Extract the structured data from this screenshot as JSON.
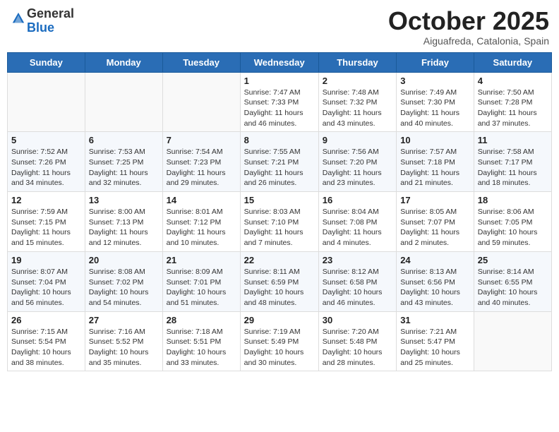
{
  "header": {
    "logo_line1": "General",
    "logo_line2": "Blue",
    "month": "October 2025",
    "location": "Aiguafreda, Catalonia, Spain"
  },
  "weekdays": [
    "Sunday",
    "Monday",
    "Tuesday",
    "Wednesday",
    "Thursday",
    "Friday",
    "Saturday"
  ],
  "weeks": [
    [
      {
        "day": "",
        "info": ""
      },
      {
        "day": "",
        "info": ""
      },
      {
        "day": "",
        "info": ""
      },
      {
        "day": "1",
        "info": "Sunrise: 7:47 AM\nSunset: 7:33 PM\nDaylight: 11 hours and 46 minutes."
      },
      {
        "day": "2",
        "info": "Sunrise: 7:48 AM\nSunset: 7:32 PM\nDaylight: 11 hours and 43 minutes."
      },
      {
        "day": "3",
        "info": "Sunrise: 7:49 AM\nSunset: 7:30 PM\nDaylight: 11 hours and 40 minutes."
      },
      {
        "day": "4",
        "info": "Sunrise: 7:50 AM\nSunset: 7:28 PM\nDaylight: 11 hours and 37 minutes."
      }
    ],
    [
      {
        "day": "5",
        "info": "Sunrise: 7:52 AM\nSunset: 7:26 PM\nDaylight: 11 hours and 34 minutes."
      },
      {
        "day": "6",
        "info": "Sunrise: 7:53 AM\nSunset: 7:25 PM\nDaylight: 11 hours and 32 minutes."
      },
      {
        "day": "7",
        "info": "Sunrise: 7:54 AM\nSunset: 7:23 PM\nDaylight: 11 hours and 29 minutes."
      },
      {
        "day": "8",
        "info": "Sunrise: 7:55 AM\nSunset: 7:21 PM\nDaylight: 11 hours and 26 minutes."
      },
      {
        "day": "9",
        "info": "Sunrise: 7:56 AM\nSunset: 7:20 PM\nDaylight: 11 hours and 23 minutes."
      },
      {
        "day": "10",
        "info": "Sunrise: 7:57 AM\nSunset: 7:18 PM\nDaylight: 11 hours and 21 minutes."
      },
      {
        "day": "11",
        "info": "Sunrise: 7:58 AM\nSunset: 7:17 PM\nDaylight: 11 hours and 18 minutes."
      }
    ],
    [
      {
        "day": "12",
        "info": "Sunrise: 7:59 AM\nSunset: 7:15 PM\nDaylight: 11 hours and 15 minutes."
      },
      {
        "day": "13",
        "info": "Sunrise: 8:00 AM\nSunset: 7:13 PM\nDaylight: 11 hours and 12 minutes."
      },
      {
        "day": "14",
        "info": "Sunrise: 8:01 AM\nSunset: 7:12 PM\nDaylight: 11 hours and 10 minutes."
      },
      {
        "day": "15",
        "info": "Sunrise: 8:03 AM\nSunset: 7:10 PM\nDaylight: 11 hours and 7 minutes."
      },
      {
        "day": "16",
        "info": "Sunrise: 8:04 AM\nSunset: 7:08 PM\nDaylight: 11 hours and 4 minutes."
      },
      {
        "day": "17",
        "info": "Sunrise: 8:05 AM\nSunset: 7:07 PM\nDaylight: 11 hours and 2 minutes."
      },
      {
        "day": "18",
        "info": "Sunrise: 8:06 AM\nSunset: 7:05 PM\nDaylight: 10 hours and 59 minutes."
      }
    ],
    [
      {
        "day": "19",
        "info": "Sunrise: 8:07 AM\nSunset: 7:04 PM\nDaylight: 10 hours and 56 minutes."
      },
      {
        "day": "20",
        "info": "Sunrise: 8:08 AM\nSunset: 7:02 PM\nDaylight: 10 hours and 54 minutes."
      },
      {
        "day": "21",
        "info": "Sunrise: 8:09 AM\nSunset: 7:01 PM\nDaylight: 10 hours and 51 minutes."
      },
      {
        "day": "22",
        "info": "Sunrise: 8:11 AM\nSunset: 6:59 PM\nDaylight: 10 hours and 48 minutes."
      },
      {
        "day": "23",
        "info": "Sunrise: 8:12 AM\nSunset: 6:58 PM\nDaylight: 10 hours and 46 minutes."
      },
      {
        "day": "24",
        "info": "Sunrise: 8:13 AM\nSunset: 6:56 PM\nDaylight: 10 hours and 43 minutes."
      },
      {
        "day": "25",
        "info": "Sunrise: 8:14 AM\nSunset: 6:55 PM\nDaylight: 10 hours and 40 minutes."
      }
    ],
    [
      {
        "day": "26",
        "info": "Sunrise: 7:15 AM\nSunset: 5:54 PM\nDaylight: 10 hours and 38 minutes."
      },
      {
        "day": "27",
        "info": "Sunrise: 7:16 AM\nSunset: 5:52 PM\nDaylight: 10 hours and 35 minutes."
      },
      {
        "day": "28",
        "info": "Sunrise: 7:18 AM\nSunset: 5:51 PM\nDaylight: 10 hours and 33 minutes."
      },
      {
        "day": "29",
        "info": "Sunrise: 7:19 AM\nSunset: 5:49 PM\nDaylight: 10 hours and 30 minutes."
      },
      {
        "day": "30",
        "info": "Sunrise: 7:20 AM\nSunset: 5:48 PM\nDaylight: 10 hours and 28 minutes."
      },
      {
        "day": "31",
        "info": "Sunrise: 7:21 AM\nSunset: 5:47 PM\nDaylight: 10 hours and 25 minutes."
      },
      {
        "day": "",
        "info": ""
      }
    ]
  ]
}
